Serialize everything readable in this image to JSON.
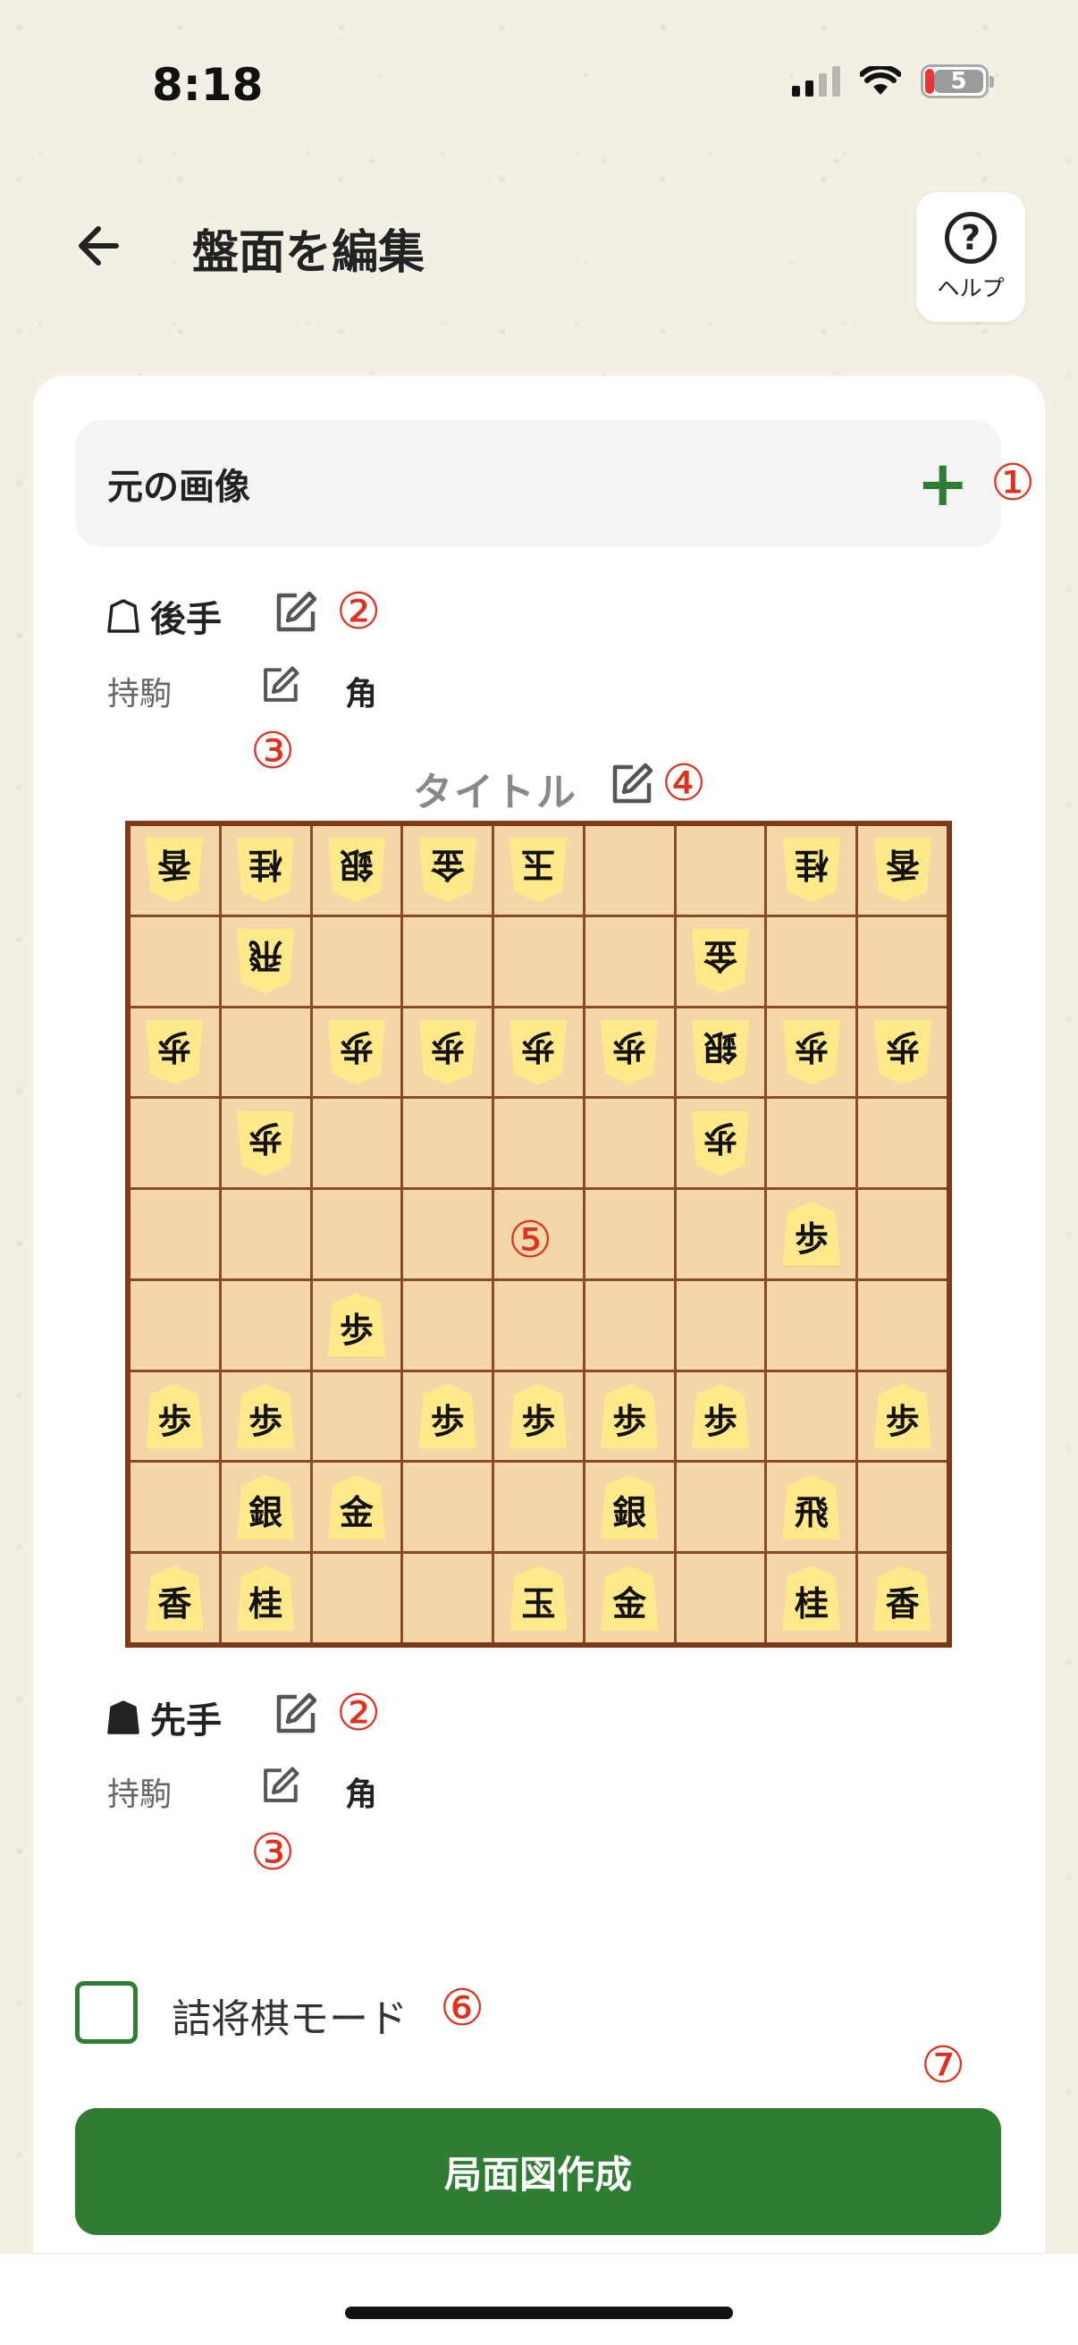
{
  "status": {
    "time": "8:18",
    "battery": "5"
  },
  "header": {
    "title": "盤面を編集",
    "help_label": "ヘルプ"
  },
  "source": {
    "label": "元の画像",
    "plus": "+"
  },
  "gote": {
    "label": "後手",
    "hand_label": "持駒",
    "hand_value": "角"
  },
  "sente": {
    "label": "先手",
    "hand_label": "持駒",
    "hand_value": "角"
  },
  "board": {
    "title": "タイトル",
    "rows": [
      [
        {
          "p": "香",
          "g": true
        },
        {
          "p": "桂",
          "g": true
        },
        {
          "p": "銀",
          "g": true
        },
        {
          "p": "金",
          "g": true
        },
        {
          "p": "玉",
          "g": true
        },
        null,
        null,
        {
          "p": "桂",
          "g": true
        },
        {
          "p": "香",
          "g": true
        }
      ],
      [
        null,
        {
          "p": "飛",
          "g": true
        },
        null,
        null,
        null,
        null,
        {
          "p": "金",
          "g": true
        },
        null,
        null
      ],
      [
        {
          "p": "歩",
          "g": true
        },
        null,
        {
          "p": "歩",
          "g": true
        },
        {
          "p": "歩",
          "g": true
        },
        {
          "p": "歩",
          "g": true
        },
        {
          "p": "歩",
          "g": true
        },
        {
          "p": "銀",
          "g": true
        },
        {
          "p": "歩",
          "g": true
        },
        {
          "p": "歩",
          "g": true
        }
      ],
      [
        null,
        {
          "p": "歩",
          "g": true
        },
        null,
        null,
        null,
        null,
        {
          "p": "歩",
          "g": true
        },
        null,
        null
      ],
      [
        null,
        null,
        null,
        null,
        null,
        null,
        null,
        {
          "p": "歩",
          "g": false
        },
        null
      ],
      [
        null,
        null,
        {
          "p": "歩",
          "g": false
        },
        null,
        null,
        null,
        null,
        null,
        null
      ],
      [
        {
          "p": "歩",
          "g": false
        },
        {
          "p": "歩",
          "g": false
        },
        null,
        {
          "p": "歩",
          "g": false
        },
        {
          "p": "歩",
          "g": false
        },
        {
          "p": "歩",
          "g": false
        },
        {
          "p": "歩",
          "g": false
        },
        null,
        {
          "p": "歩",
          "g": false
        }
      ],
      [
        null,
        {
          "p": "銀",
          "g": false
        },
        {
          "p": "金",
          "g": false
        },
        null,
        null,
        {
          "p": "銀",
          "g": false
        },
        null,
        {
          "p": "飛",
          "g": false
        },
        null
      ],
      [
        {
          "p": "香",
          "g": false
        },
        {
          "p": "桂",
          "g": false
        },
        null,
        null,
        {
          "p": "玉",
          "g": false
        },
        {
          "p": "金",
          "g": false
        },
        null,
        {
          "p": "桂",
          "g": false
        },
        {
          "p": "香",
          "g": false
        }
      ]
    ]
  },
  "tsume_mode": {
    "label": "詰将棋モード",
    "checked": false
  },
  "submit": {
    "label": "局面図作成"
  },
  "markers": {
    "m1": "①",
    "m2": "②",
    "m3": "③",
    "m4": "④",
    "m5": "⑤",
    "m6": "⑥",
    "m7": "⑦"
  },
  "colors": {
    "accent": "#2e7d32",
    "marker": "#e0301e",
    "board_frame": "#7e3a1b",
    "board_cell": "#f4d7a8",
    "piece": "#ffe98a"
  }
}
